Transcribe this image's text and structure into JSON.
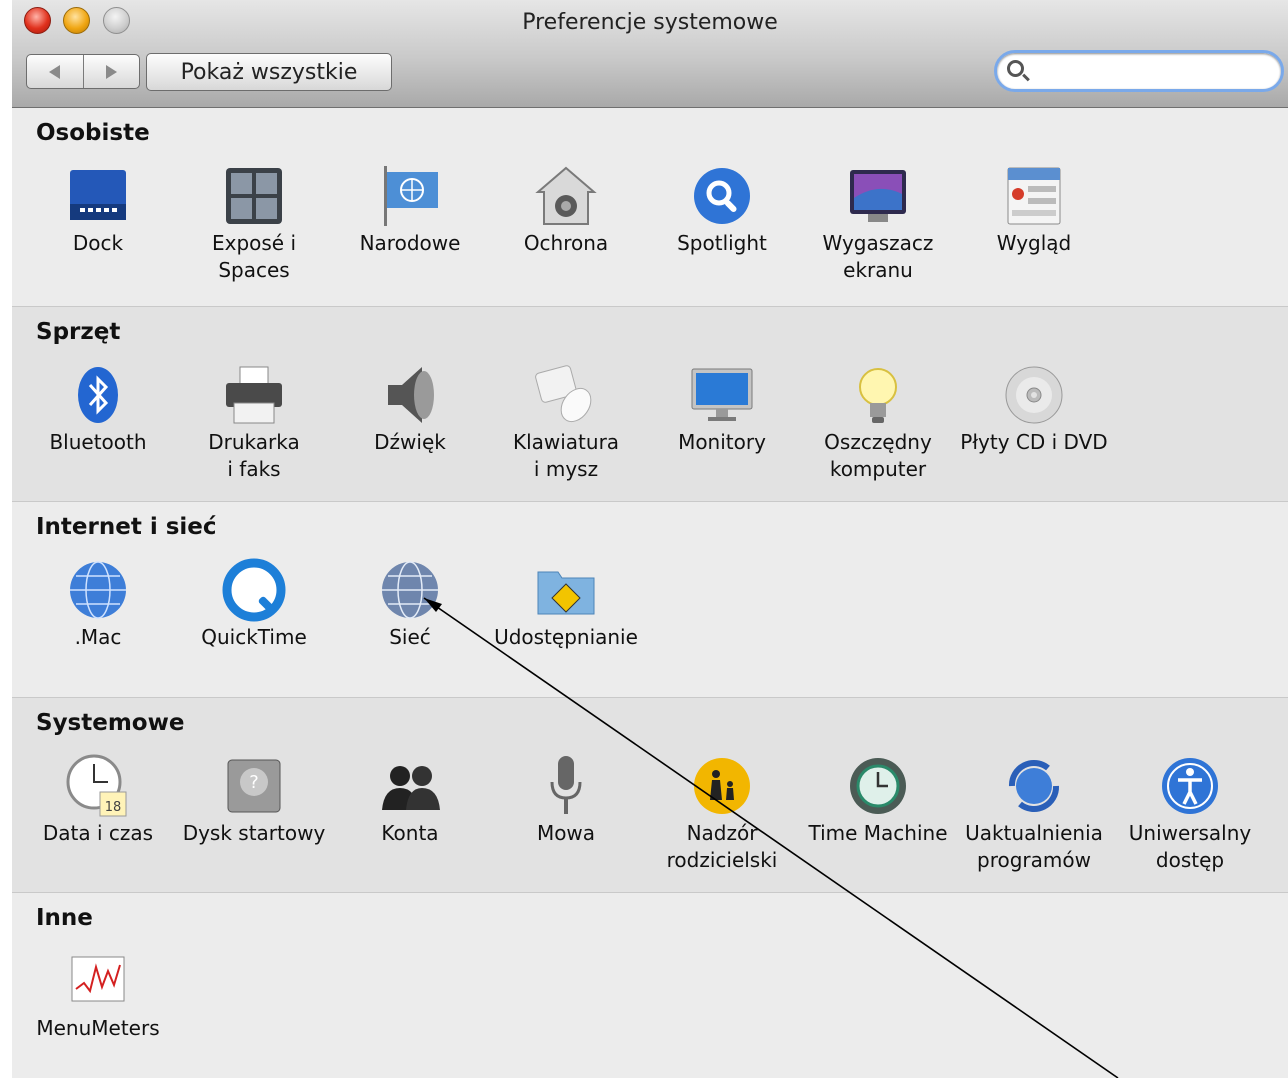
{
  "window": {
    "title": "Preferencje systemowe"
  },
  "toolbar": {
    "back_icon": "back-arrow-icon",
    "forward_icon": "forward-arrow-icon",
    "show_all_label": "Pokaż wszystkie",
    "search": {
      "value": "",
      "placeholder": "",
      "icon": "search-icon"
    }
  },
  "sections": [
    {
      "title": "Osobiste",
      "panes": [
        {
          "label": "Dock",
          "icon": "dock-icon"
        },
        {
          "label": "Exposé i\nSpaces",
          "icon": "expose-spaces-icon"
        },
        {
          "label": "Narodowe",
          "icon": "international-flag-icon"
        },
        {
          "label": "Ochrona",
          "icon": "security-house-icon"
        },
        {
          "label": "Spotlight",
          "icon": "spotlight-magnifier-icon"
        },
        {
          "label": "Wygaszacz\nekranu",
          "icon": "screensaver-icon"
        },
        {
          "label": "Wygląd",
          "icon": "appearance-icon"
        }
      ]
    },
    {
      "title": "Sprzęt",
      "panes": [
        {
          "label": "Bluetooth",
          "icon": "bluetooth-icon"
        },
        {
          "label": "Drukarka\ni faks",
          "icon": "printer-icon"
        },
        {
          "label": "Dźwięk",
          "icon": "speaker-icon"
        },
        {
          "label": "Klawiatura\ni mysz",
          "icon": "keyboard-mouse-icon"
        },
        {
          "label": "Monitory",
          "icon": "display-icon"
        },
        {
          "label": "Oszczędny\nkomputer",
          "icon": "lightbulb-icon"
        },
        {
          "label": "Płyty CD i DVD",
          "icon": "cd-dvd-icon"
        }
      ]
    },
    {
      "title": "Internet i sieć",
      "panes": [
        {
          "label": ".Mac",
          "icon": "mac-globe-icon"
        },
        {
          "label": "QuickTime",
          "icon": "quicktime-icon"
        },
        {
          "label": "Sieć",
          "icon": "network-globe-icon"
        },
        {
          "label": "Udostępnianie",
          "icon": "sharing-folder-icon"
        }
      ]
    },
    {
      "title": "Systemowe",
      "panes": [
        {
          "label": "Data i czas",
          "icon": "clock-calendar-icon",
          "badge": "18"
        },
        {
          "label": "Dysk startowy",
          "icon": "startup-disk-icon"
        },
        {
          "label": "Konta",
          "icon": "accounts-people-icon"
        },
        {
          "label": "Mowa",
          "icon": "microphone-icon"
        },
        {
          "label": "Nadzór\nrodzicielski",
          "icon": "parental-controls-icon"
        },
        {
          "label": "Time Machine",
          "icon": "time-machine-icon"
        },
        {
          "label": "Uaktualnienia\nprogramów",
          "icon": "software-update-icon"
        },
        {
          "label": "Uniwersalny\ndostęp",
          "icon": "universal-access-icon"
        }
      ]
    },
    {
      "title": "Inne",
      "panes": [
        {
          "label": "MenuMeters",
          "icon": "menumeters-graph-icon"
        }
      ]
    }
  ],
  "colors": {
    "window_bg": "#ececec",
    "alt_section_bg": "#e2e2e2",
    "search_focus": "#7aa9ea"
  }
}
